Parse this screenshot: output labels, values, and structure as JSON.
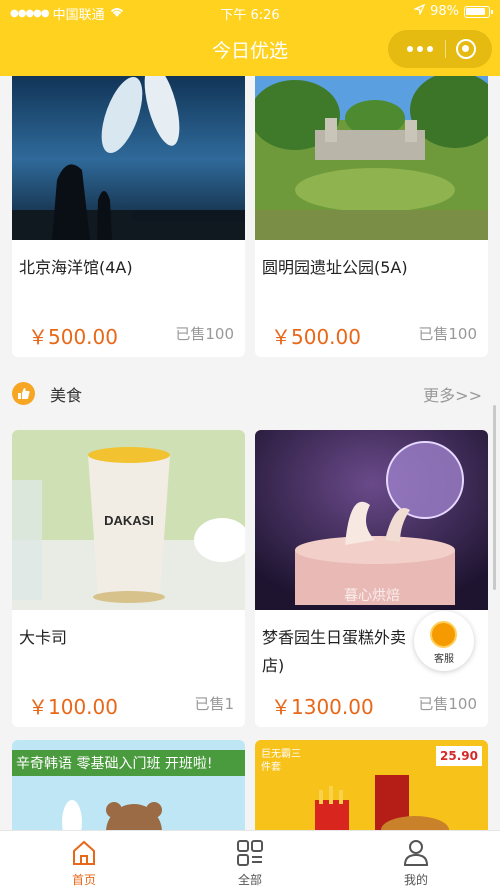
{
  "status_bar": {
    "carrier": "中国联通",
    "time": "下午 6:26",
    "battery": "98%"
  },
  "nav": {
    "title": "今日优选"
  },
  "top_items": [
    {
      "name": "北京海洋馆(4A)",
      "price": "￥500.00",
      "sold": "已售100"
    },
    {
      "name": "圆明园遗址公园(5A)",
      "price": "￥500.00",
      "sold": "已售100"
    }
  ],
  "section": {
    "title": "美食",
    "more": "更多>>"
  },
  "food_items": [
    {
      "name": "大卡司",
      "price": "￥100.00",
      "sold": "已售1"
    },
    {
      "name": "梦香园生日蛋糕外卖店)",
      "price": "￥1300.00",
      "sold": "已售100"
    }
  ],
  "partial_items": [
    {
      "banner_text": "辛奇韩语 零基础入门班 开班啦!"
    },
    {
      "badge_left": "巨无霸三件套",
      "badge_right": "25.90"
    }
  ],
  "image_overlays": {
    "cup_brand": "DAKASI",
    "cake_watermark": "暮心烘焙"
  },
  "service": {
    "label": "客服"
  },
  "tabbar": {
    "home": "首页",
    "all": "全部",
    "mine": "我的"
  },
  "colors": {
    "brand": "#ffd21f",
    "price": "#e8681a",
    "tab_active": "#e8681a"
  }
}
